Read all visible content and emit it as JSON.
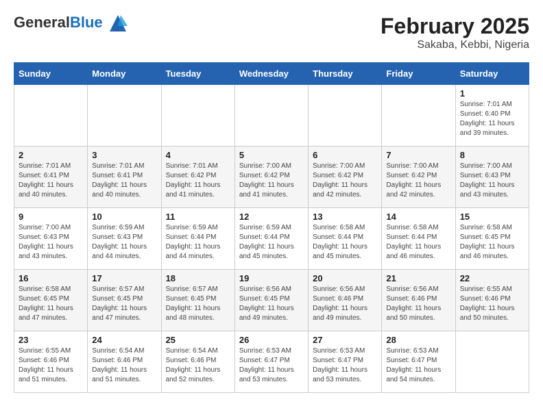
{
  "logo": {
    "general": "General",
    "blue": "Blue"
  },
  "title": "February 2025",
  "subtitle": "Sakaba, Kebbi, Nigeria",
  "days_of_week": [
    "Sunday",
    "Monday",
    "Tuesday",
    "Wednesday",
    "Thursday",
    "Friday",
    "Saturday"
  ],
  "weeks": [
    [
      {
        "day": "",
        "info": ""
      },
      {
        "day": "",
        "info": ""
      },
      {
        "day": "",
        "info": ""
      },
      {
        "day": "",
        "info": ""
      },
      {
        "day": "",
        "info": ""
      },
      {
        "day": "",
        "info": ""
      },
      {
        "day": "1",
        "info": "Sunrise: 7:01 AM\nSunset: 6:40 PM\nDaylight: 11 hours and 39 minutes."
      }
    ],
    [
      {
        "day": "2",
        "info": "Sunrise: 7:01 AM\nSunset: 6:41 PM\nDaylight: 11 hours and 40 minutes."
      },
      {
        "day": "3",
        "info": "Sunrise: 7:01 AM\nSunset: 6:41 PM\nDaylight: 11 hours and 40 minutes."
      },
      {
        "day": "4",
        "info": "Sunrise: 7:01 AM\nSunset: 6:42 PM\nDaylight: 11 hours and 41 minutes."
      },
      {
        "day": "5",
        "info": "Sunrise: 7:00 AM\nSunset: 6:42 PM\nDaylight: 11 hours and 41 minutes."
      },
      {
        "day": "6",
        "info": "Sunrise: 7:00 AM\nSunset: 6:42 PM\nDaylight: 11 hours and 42 minutes."
      },
      {
        "day": "7",
        "info": "Sunrise: 7:00 AM\nSunset: 6:42 PM\nDaylight: 11 hours and 42 minutes."
      },
      {
        "day": "8",
        "info": "Sunrise: 7:00 AM\nSunset: 6:43 PM\nDaylight: 11 hours and 43 minutes."
      }
    ],
    [
      {
        "day": "9",
        "info": "Sunrise: 7:00 AM\nSunset: 6:43 PM\nDaylight: 11 hours and 43 minutes."
      },
      {
        "day": "10",
        "info": "Sunrise: 6:59 AM\nSunset: 6:43 PM\nDaylight: 11 hours and 44 minutes."
      },
      {
        "day": "11",
        "info": "Sunrise: 6:59 AM\nSunset: 6:44 PM\nDaylight: 11 hours and 44 minutes."
      },
      {
        "day": "12",
        "info": "Sunrise: 6:59 AM\nSunset: 6:44 PM\nDaylight: 11 hours and 45 minutes."
      },
      {
        "day": "13",
        "info": "Sunrise: 6:58 AM\nSunset: 6:44 PM\nDaylight: 11 hours and 45 minutes."
      },
      {
        "day": "14",
        "info": "Sunrise: 6:58 AM\nSunset: 6:44 PM\nDaylight: 11 hours and 46 minutes."
      },
      {
        "day": "15",
        "info": "Sunrise: 6:58 AM\nSunset: 6:45 PM\nDaylight: 11 hours and 46 minutes."
      }
    ],
    [
      {
        "day": "16",
        "info": "Sunrise: 6:58 AM\nSunset: 6:45 PM\nDaylight: 11 hours and 47 minutes."
      },
      {
        "day": "17",
        "info": "Sunrise: 6:57 AM\nSunset: 6:45 PM\nDaylight: 11 hours and 47 minutes."
      },
      {
        "day": "18",
        "info": "Sunrise: 6:57 AM\nSunset: 6:45 PM\nDaylight: 11 hours and 48 minutes."
      },
      {
        "day": "19",
        "info": "Sunrise: 6:56 AM\nSunset: 6:45 PM\nDaylight: 11 hours and 49 minutes."
      },
      {
        "day": "20",
        "info": "Sunrise: 6:56 AM\nSunset: 6:46 PM\nDaylight: 11 hours and 49 minutes."
      },
      {
        "day": "21",
        "info": "Sunrise: 6:56 AM\nSunset: 6:46 PM\nDaylight: 11 hours and 50 minutes."
      },
      {
        "day": "22",
        "info": "Sunrise: 6:55 AM\nSunset: 6:46 PM\nDaylight: 11 hours and 50 minutes."
      }
    ],
    [
      {
        "day": "23",
        "info": "Sunrise: 6:55 AM\nSunset: 6:46 PM\nDaylight: 11 hours and 51 minutes."
      },
      {
        "day": "24",
        "info": "Sunrise: 6:54 AM\nSunset: 6:46 PM\nDaylight: 11 hours and 51 minutes."
      },
      {
        "day": "25",
        "info": "Sunrise: 6:54 AM\nSunset: 6:46 PM\nDaylight: 11 hours and 52 minutes."
      },
      {
        "day": "26",
        "info": "Sunrise: 6:53 AM\nSunset: 6:47 PM\nDaylight: 11 hours and 53 minutes."
      },
      {
        "day": "27",
        "info": "Sunrise: 6:53 AM\nSunset: 6:47 PM\nDaylight: 11 hours and 53 minutes."
      },
      {
        "day": "28",
        "info": "Sunrise: 6:53 AM\nSunset: 6:47 PM\nDaylight: 11 hours and 54 minutes."
      },
      {
        "day": "",
        "info": ""
      }
    ]
  ]
}
